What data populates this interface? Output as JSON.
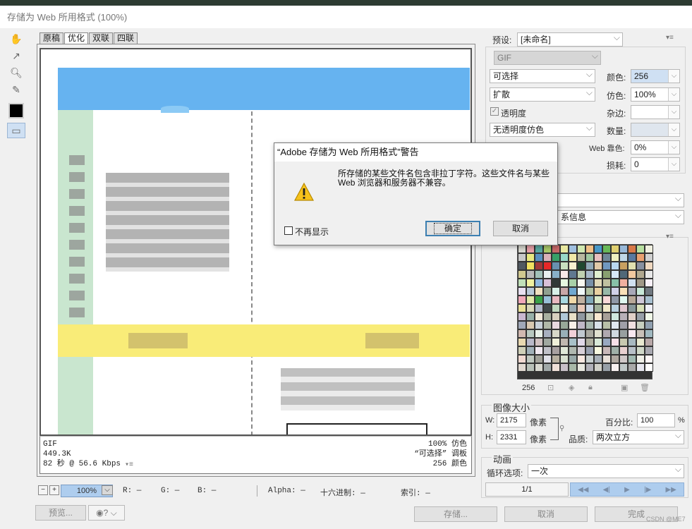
{
  "window": {
    "title": "存储为 Web 所用格式 (100%)"
  },
  "tabs": [
    {
      "label": "原稿"
    },
    {
      "label": "优化"
    },
    {
      "label": "双联"
    },
    {
      "label": "四联"
    }
  ],
  "image_info": {
    "format": "GIF",
    "size": "449.3K",
    "speed": "82 秒 @ 56.6 Kbps",
    "dither": "100% 仿色",
    "palette": "“可选择” 调板",
    "colors": "256 颜色"
  },
  "statusbar": {
    "zoom": "100%",
    "r": "R: —",
    "g": "G: —",
    "b": "B: —",
    "alpha": "Alpha: —",
    "hex": "十六进制: —",
    "index": "索引: —"
  },
  "bottom_buttons": {
    "preview": "预览...",
    "save": "存储...",
    "cancel": "取消",
    "done": "完成"
  },
  "settings": {
    "preset_label": "预设:",
    "preset_value": "[未命名]",
    "format": "GIF",
    "palette": "可选择",
    "dither_algo": "扩散",
    "transparency": "透明度",
    "transparency_dither": "无透明度仿色",
    "colors_label": "颜色:",
    "colors_value": "256",
    "dither_label": "仿色:",
    "dither_value": "100%",
    "matte_label": "杂边:",
    "amount_label": "数量:",
    "websnap_label": "Web 靠色:",
    "websnap_value": "0%",
    "lossy_label": "损耗:",
    "lossy_value": "0",
    "metadata_partial": "系信息"
  },
  "color_table": {
    "count": "256",
    "swatches": [
      "#d8d8d0",
      "#e8a0a8",
      "#58a8a0",
      "#a8c868",
      "#c86868",
      "#e8e8a0",
      "#a0c0e0",
      "#d0e8b0",
      "#f0c088",
      "#4898c8",
      "#68b858",
      "#e0d070",
      "#98b8d8",
      "#d87848",
      "#b8e0a0",
      "#f0f0e0",
      "#c8c8c8",
      "#e8e880",
      "#5890c0",
      "#d8b0b8",
      "#38a068",
      "#98d8c8",
      "#f0e8a8",
      "#b8b8a0",
      "#a0c8a0",
      "#e8c0c0",
      "#708898",
      "#f0f0c0",
      "#c0d8e8",
      "#5878a0",
      "#e8a070",
      "#d0d0d0",
      "#505860",
      "#f0e060",
      "#a03838",
      "#e82828",
      "#6890b0",
      "#c8e0c0",
      "#f8f0d0",
      "#204830",
      "#90a8b8",
      "#e0c8a8",
      "#7098c0",
      "#b8d8f0",
      "#c8a060",
      "#e0e0b0",
      "#8890a0",
      "#f0d8c0",
      "#d0c890",
      "#b8b8b8",
      "#a0c0b8",
      "#e8f0f0",
      "#88b0c8",
      "#f8e8e8",
      "#607890",
      "#c0d0b0",
      "#a8b8c8",
      "#e0f0d0",
      "#88a070",
      "#d8e8f8",
      "#506878",
      "#f0c8a0",
      "#b0a890",
      "#e8e8e8",
      "#c0e0b8",
      "#f0f0a0",
      "#90b8e0",
      "#d8c0d8",
      "#303838",
      "#e8f8e0",
      "#a8d0a8",
      "#f8f8f0",
      "#7890a8",
      "#e0d8b8",
      "#c0c0a0",
      "#88c0a8",
      "#f0b0a0",
      "#d0e0f0",
      "#a09888",
      "#f8f0f8",
      "#e8e0f0",
      "#b8c8d8",
      "#f0e0c0",
      "#90a090",
      "#d8f0e8",
      "#c8a8a8",
      "#70a8d0",
      "#f0f8f8",
      "#b0c0a0",
      "#e8d0a0",
      "#98b8a8",
      "#d0d0e8",
      "#f8e0b8",
      "#a8a8b8",
      "#c8e8d8",
      "#707880",
      "#f0a8b8",
      "#e0e8a8",
      "#38a048",
      "#98c0d8",
      "#e8b8c0",
      "#a8d8e0",
      "#f0d8a8",
      "#c0b0a0",
      "#80a8b8",
      "#d8e8c8",
      "#f8d8d8",
      "#9098a8",
      "#e0f8f0",
      "#b8a898",
      "#d0c8d8",
      "#a8c0d0",
      "#e8e098",
      "#d8d8b8",
      "#b0b8c8",
      "#404848",
      "#c0d8c0",
      "#f8f0e0",
      "#98a8b0",
      "#e8c8b8",
      "#c8d8e8",
      "#a0b098",
      "#f0e8c8",
      "#b8d0e0",
      "#e0c8d0",
      "#88989a",
      "#d8e0b8",
      "#f0f0f8",
      "#c8b8d0",
      "#98b0a8",
      "#f0e8d8",
      "#a8b0a0",
      "#d8d0c0",
      "#b0c8d8",
      "#e8e0c8",
      "#9098a0",
      "#c0c8b8",
      "#f8e8d0",
      "#a8a098",
      "#d0e8e0",
      "#b8b0b8",
      "#e0d0c8",
      "#98a0a8",
      "#f0f8e8",
      "#a0a8b8",
      "#d8c8b0",
      "#c8d0d8",
      "#b0b8a8",
      "#e8d8e0",
      "#98a898",
      "#f8f0e8",
      "#c0b8c8",
      "#a8b8b0",
      "#d8e0e8",
      "#b8c0a8",
      "#e0e8f0",
      "#a0a0a8",
      "#f0e0e0",
      "#c8d0c0",
      "#90a0b0",
      "#d0b8b0",
      "#b8c8c0",
      "#e8f0e8",
      "#a8b0c0",
      "#d8d8c8",
      "#98b0b8",
      "#f0d0d8",
      "#c0c8d0",
      "#a8a8a0",
      "#e0e0d0",
      "#b0a8b0",
      "#d0d8e0",
      "#98a0a0",
      "#f8e8f0",
      "#c8c0b8",
      "#a0b8c0",
      "#e8d8b0",
      "#b8b8c8",
      "#d0c0c0",
      "#a0a8a0",
      "#f0f0d8",
      "#c0b8b0",
      "#a8c0c8",
      "#e0d8e8",
      "#b0b0a0",
      "#d8e8d8",
      "#98a8c0",
      "#f8e0e8",
      "#c8c8b0",
      "#a8b8c0",
      "#e8e8d0",
      "#b8a8a8",
      "#d0d0b8",
      "#a0b0b8",
      "#f0e8f0",
      "#c0c0c8",
      "#a8a0a0",
      "#e0e8d8",
      "#b0b8b0",
      "#d8d0d8",
      "#98a0b0",
      "#f8f8e0",
      "#c8b8b8",
      "#a0b0a8",
      "#e8d0d0",
      "#b8c0c8",
      "#d0d8c8",
      "#a8a8b0",
      "#f0d8d0",
      "#c0c8c0",
      "#a0a098",
      "#e0e0e8",
      "#b8b0a0",
      "#d8e0d0",
      "#98a8a8",
      "#f8e8e0",
      "#c8d0d0",
      "#a8b0b8",
      "#e8e0d8",
      "#b0a8a0",
      "#d0c8c8",
      "#a0b8b0",
      "#f0f0e8",
      "#fff8f8",
      "#e0d8d0",
      "#b8c0b8",
      "#d8d8d0",
      "#a0a8a8",
      "#f0e0d8",
      "#c8c0c8",
      "#a8b8a8",
      "#e8e8e0",
      "#b0b0b8",
      "#d0d0c8",
      "#98a0a8",
      "#f8f0f0",
      "#c0c8c8",
      "#a8a8a8",
      "#e8e8f0",
      "#ffffff"
    ]
  },
  "image_size": {
    "heading": "图像大小",
    "w_label": "W:",
    "w_value": "2175",
    "h_label": "H:",
    "h_value": "2331",
    "unit": "像素",
    "percent_label": "百分比:",
    "percent_value": "100",
    "percent_unit": "%",
    "quality_label": "品质:",
    "quality_value": "两次立方"
  },
  "animation": {
    "heading": "动画",
    "loop_label": "循环选项:",
    "loop_value": "一次",
    "frame": "1/1"
  },
  "dialog": {
    "title": "“Adobe 存储为 Web 所用格式”警告",
    "message": "所存储的某些文件名包含非拉丁字符。这些文件名与某些 Web 浏览器和服务器不兼容。",
    "checkbox_label": "不再显示",
    "ok": "确定",
    "cancel": "取消"
  },
  "watermark": "CSDN @ME7"
}
